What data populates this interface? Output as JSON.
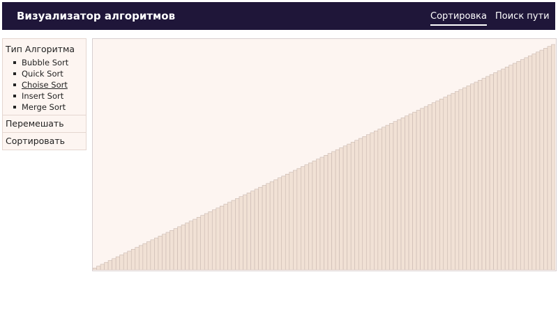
{
  "header": {
    "title": "Визуализатор алгоритмов",
    "nav": [
      {
        "label": "Сортировка",
        "active": true
      },
      {
        "label": "Поиск пути",
        "active": false
      }
    ]
  },
  "sidebar": {
    "section_title": "Тип Алгоритма",
    "algorithms": [
      {
        "label": "Bubble Sort",
        "selected": false
      },
      {
        "label": "Quick Sort",
        "selected": false
      },
      {
        "label": "Choise Sort",
        "selected": true
      },
      {
        "label": "Insert Sort",
        "selected": false
      },
      {
        "label": "Merge Sort",
        "selected": false
      }
    ],
    "shuffle_label": "Перемешать",
    "sort_label": "Сортировать"
  },
  "colors": {
    "header_bg": "#1f1639",
    "panel_bg": "#fdf5f1",
    "bar_fill": "#f1e1d5",
    "bar_stroke": "#c9b8b0"
  },
  "chart_data": {
    "type": "bar",
    "bar_count": 120,
    "values_rule": "sorted ascending 1..120",
    "ylim": [
      0,
      120
    ]
  }
}
